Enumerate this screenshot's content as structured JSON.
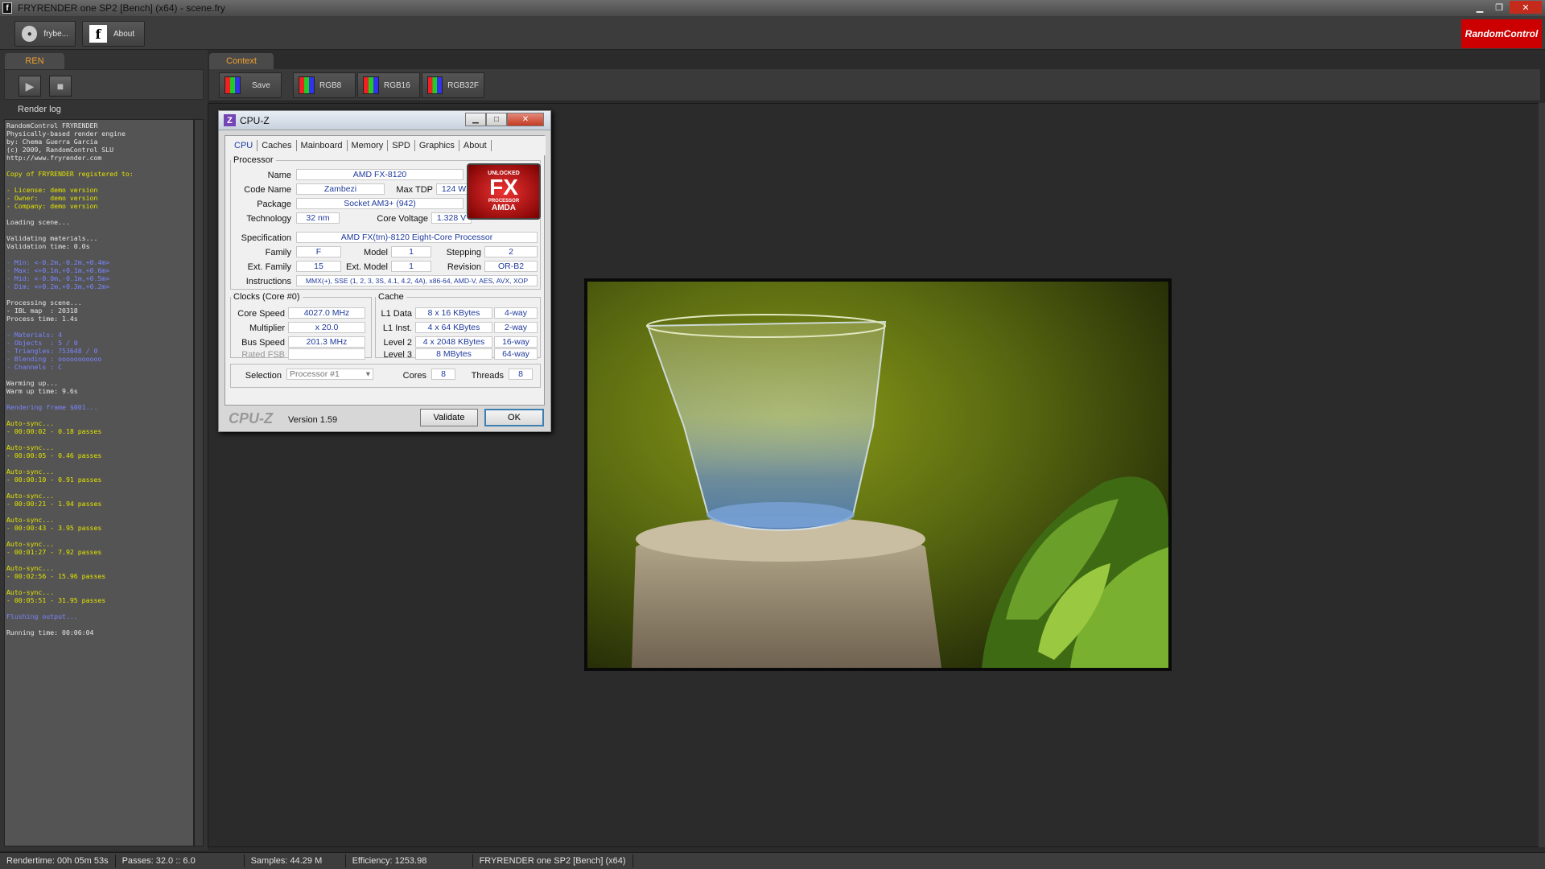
{
  "window": {
    "title": "FRYRENDER one SP2 [Bench] (x64) - scene.fry",
    "app_icon": "f"
  },
  "toolbar": {
    "frybench_label": "frybe...",
    "about_label": "About",
    "brand": "RandomControl"
  },
  "left": {
    "tab": "REN",
    "render_log_label": "Render log",
    "log": [
      {
        "t": "RandomControl FRYRENDER",
        "c": "w"
      },
      {
        "t": "Physically-based render engine",
        "c": "w"
      },
      {
        "t": "by: Chema Guerra Garcia",
        "c": "w"
      },
      {
        "t": "(c) 2009, RandomControl SLU",
        "c": "w"
      },
      {
        "t": "http://www.fryrender.com",
        "c": "w"
      },
      {
        "t": "",
        "c": "w"
      },
      {
        "t": "Copy of FRYRENDER registered to:",
        "c": "y"
      },
      {
        "t": "",
        "c": "w"
      },
      {
        "t": "- License: demo version",
        "c": "y"
      },
      {
        "t": "- Owner:   demo version",
        "c": "y"
      },
      {
        "t": "- Company: demo version",
        "c": "y"
      },
      {
        "t": "",
        "c": "w"
      },
      {
        "t": "Loading scene...",
        "c": "w"
      },
      {
        "t": "",
        "c": "w"
      },
      {
        "t": "Validating materials...",
        "c": "w"
      },
      {
        "t": "Validation time: 0.0s",
        "c": "w"
      },
      {
        "t": "",
        "c": "w"
      },
      {
        "t": "- Min: <-0.2m,-0.2m,+0.4m>",
        "c": "b"
      },
      {
        "t": "- Max: <+0.1m,+0.1m,+0.6m>",
        "c": "b"
      },
      {
        "t": "- Mid: <-0.0m,-0.1m,+0.5m>",
        "c": "b"
      },
      {
        "t": "- Dim: <+0.2m,+0.3m,+0.2m>",
        "c": "b"
      },
      {
        "t": "",
        "c": "w"
      },
      {
        "t": "Processing scene...",
        "c": "w"
      },
      {
        "t": "- IBL map  : 20318",
        "c": "w"
      },
      {
        "t": "Process time: 1.4s",
        "c": "w"
      },
      {
        "t": "",
        "c": "w"
      },
      {
        "t": "- Materials: 4",
        "c": "b"
      },
      {
        "t": "- Objects  : 5 / 0",
        "c": "b"
      },
      {
        "t": "- Triangles: 753648 / 0",
        "c": "b"
      },
      {
        "t": "- Blending : ooooooooooo",
        "c": "b"
      },
      {
        "t": "- Channels : C",
        "c": "b"
      },
      {
        "t": "",
        "c": "w"
      },
      {
        "t": "Warming up...",
        "c": "w"
      },
      {
        "t": "Warm up time: 9.6s",
        "c": "w"
      },
      {
        "t": "",
        "c": "w"
      },
      {
        "t": "Rendering frame $001...",
        "c": "b"
      },
      {
        "t": "",
        "c": "w"
      },
      {
        "t": "Auto-sync...",
        "c": "y"
      },
      {
        "t": "- 00:00:02 - 0.18 passes",
        "c": "y"
      },
      {
        "t": "",
        "c": "w"
      },
      {
        "t": "Auto-sync...",
        "c": "y"
      },
      {
        "t": "- 00:00:05 - 0.46 passes",
        "c": "y"
      },
      {
        "t": "",
        "c": "w"
      },
      {
        "t": "Auto-sync...",
        "c": "y"
      },
      {
        "t": "- 00:00:10 - 0.91 passes",
        "c": "y"
      },
      {
        "t": "",
        "c": "w"
      },
      {
        "t": "Auto-sync...",
        "c": "y"
      },
      {
        "t": "- 00:00:21 - 1.94 passes",
        "c": "y"
      },
      {
        "t": "",
        "c": "w"
      },
      {
        "t": "Auto-sync...",
        "c": "y"
      },
      {
        "t": "- 00:00:43 - 3.95 passes",
        "c": "y"
      },
      {
        "t": "",
        "c": "w"
      },
      {
        "t": "Auto-sync...",
        "c": "y"
      },
      {
        "t": "- 00:01:27 - 7.92 passes",
        "c": "y"
      },
      {
        "t": "",
        "c": "w"
      },
      {
        "t": "Auto-sync...",
        "c": "y"
      },
      {
        "t": "- 00:02:56 - 15.96 passes",
        "c": "y"
      },
      {
        "t": "",
        "c": "w"
      },
      {
        "t": "Auto-sync...",
        "c": "y"
      },
      {
        "t": "- 00:05:51 - 31.95 passes",
        "c": "y"
      },
      {
        "t": "",
        "c": "w"
      },
      {
        "t": "Flushing output...",
        "c": "b"
      },
      {
        "t": "",
        "c": "w"
      },
      {
        "t": "Running time: 00:06:04",
        "c": "w"
      }
    ]
  },
  "context": {
    "tab": "Context",
    "buttons": {
      "save": "Save",
      "rgb8": "RGB8",
      "rgb16": "RGB16",
      "rgb32f": "RGB32F"
    }
  },
  "cpuz": {
    "title": "CPU-Z",
    "tabs": [
      "CPU",
      "Caches",
      "Mainboard",
      "Memory",
      "SPD",
      "Graphics",
      "About"
    ],
    "processor_legend": "Processor",
    "name_label": "Name",
    "name": "AMD FX-8120",
    "codename_label": "Code Name",
    "codename": "Zambezi",
    "maxtdp_label": "Max TDP",
    "maxtdp": "124 W",
    "package_label": "Package",
    "package": "Socket AM3+ (942)",
    "technology_label": "Technology",
    "technology": "32 nm",
    "corevoltage_label": "Core Voltage",
    "corevoltage": "1.328 V",
    "spec_label": "Specification",
    "spec": "AMD FX(tm)-8120 Eight-Core Processor",
    "family_label": "Family",
    "family": "F",
    "model_label": "Model",
    "model": "1",
    "stepping_label": "Stepping",
    "stepping": "2",
    "extfamily_label": "Ext. Family",
    "extfamily": "15",
    "extmodel_label": "Ext. Model",
    "extmodel": "1",
    "revision_label": "Revision",
    "revision": "OR-B2",
    "instructions_label": "Instructions",
    "instructions": "MMX(+), SSE (1, 2, 3, 3S, 4.1, 4.2, 4A), x86-64, AMD-V, AES, AVX, XOP",
    "clocks_legend": "Clocks (Core #0)",
    "corespeed_label": "Core Speed",
    "corespeed": "4027.0 MHz",
    "multiplier_label": "Multiplier",
    "multiplier": "x 20.0",
    "busspeed_label": "Bus Speed",
    "busspeed": "201.3 MHz",
    "ratedfsb_label": "Rated FSB",
    "ratedfsb": "",
    "cache_legend": "Cache",
    "l1data_label": "L1 Data",
    "l1data": "8 x 16 KBytes",
    "l1data_way": "4-way",
    "l1inst_label": "L1 Inst.",
    "l1inst": "4 x 64 KBytes",
    "l1inst_way": "2-way",
    "level2_label": "Level 2",
    "level2": "4 x 2048 KBytes",
    "level2_way": "16-way",
    "level3_label": "Level 3",
    "level3": "8 MBytes",
    "level3_way": "64-way",
    "selection_label": "Selection",
    "selection": "Processor #1",
    "cores_label": "Cores",
    "cores": "8",
    "threads_label": "Threads",
    "threads": "8",
    "brand_footer": "CPU-Z",
    "version": "Version 1.59",
    "validate_label": "Validate",
    "ok_label": "OK",
    "logo": {
      "top": "UNLOCKED",
      "fx": "FX",
      "sub": "PROCESSOR",
      "amd": "AMDA"
    }
  },
  "statusbar": {
    "rendertime": "Rendertime: 00h 05m 53s",
    "passes": "Passes: 32.0 :: 6.0",
    "samples": "Samples: 44.29 M",
    "efficiency": "Efficiency: 1253.98",
    "product": "FRYRENDER one SP2 [Bench] (x64)"
  }
}
